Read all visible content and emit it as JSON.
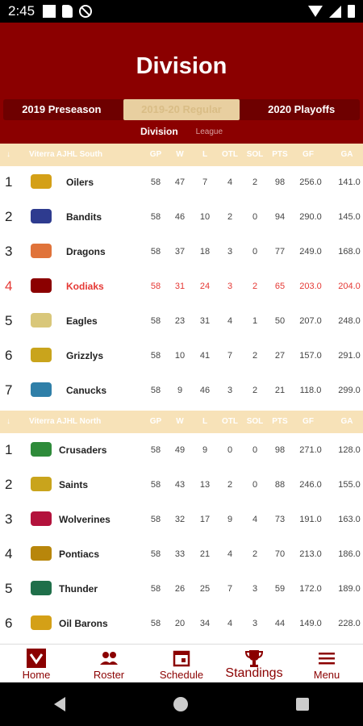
{
  "status": {
    "time": "2:45"
  },
  "header": {
    "title": "Division",
    "seasons": [
      "2019 Preseason",
      "2019-20 Regular",
      "2020 Playoffs"
    ],
    "subtabs": [
      "Division",
      "League"
    ]
  },
  "columns": [
    "GP",
    "W",
    "L",
    "OTL",
    "SOL",
    "PTS",
    "GF",
    "GA"
  ],
  "south": {
    "name": "Viterra AJHL South",
    "rows": [
      {
        "rank": "1",
        "team": "Oilers",
        "gp": "58",
        "w": "47",
        "l": "7",
        "otl": "4",
        "sol": "2",
        "pts": "98",
        "gf": "256.0",
        "ga": "141.0",
        "color": "#d4a017"
      },
      {
        "rank": "2",
        "team": "Bandits",
        "gp": "58",
        "w": "46",
        "l": "10",
        "otl": "2",
        "sol": "0",
        "pts": "94",
        "gf": "290.0",
        "ga": "145.0",
        "color": "#2e3b8f"
      },
      {
        "rank": "3",
        "team": "Dragons",
        "gp": "58",
        "w": "37",
        "l": "18",
        "otl": "3",
        "sol": "0",
        "pts": "77",
        "gf": "249.0",
        "ga": "168.0",
        "color": "#e0733a"
      },
      {
        "rank": "4",
        "team": "Kodiaks",
        "gp": "58",
        "w": "31",
        "l": "24",
        "otl": "3",
        "sol": "2",
        "pts": "65",
        "gf": "203.0",
        "ga": "204.0",
        "color": "#8b0000",
        "hl": true
      },
      {
        "rank": "5",
        "team": "Eagles",
        "gp": "58",
        "w": "23",
        "l": "31",
        "otl": "4",
        "sol": "1",
        "pts": "50",
        "gf": "207.0",
        "ga": "248.0",
        "color": "#d9c77a"
      },
      {
        "rank": "6",
        "team": "Grizzlys",
        "gp": "58",
        "w": "10",
        "l": "41",
        "otl": "7",
        "sol": "2",
        "pts": "27",
        "gf": "157.0",
        "ga": "291.0",
        "color": "#c9a41c"
      },
      {
        "rank": "7",
        "team": "Canucks",
        "gp": "58",
        "w": "9",
        "l": "46",
        "otl": "3",
        "sol": "2",
        "pts": "21",
        "gf": "118.0",
        "ga": "299.0",
        "color": "#2f7fa8"
      }
    ]
  },
  "north": {
    "name": "Viterra AJHL North",
    "rows": [
      {
        "rank": "1",
        "team": "Crusaders",
        "gp": "58",
        "w": "49",
        "l": "9",
        "otl": "0",
        "sol": "0",
        "pts": "98",
        "gf": "271.0",
        "ga": "128.0",
        "color": "#2e8b3a"
      },
      {
        "rank": "2",
        "team": "Saints",
        "gp": "58",
        "w": "43",
        "l": "13",
        "otl": "2",
        "sol": "0",
        "pts": "88",
        "gf": "246.0",
        "ga": "155.0",
        "color": "#c9a41c"
      },
      {
        "rank": "3",
        "team": "Wolverines",
        "gp": "58",
        "w": "32",
        "l": "17",
        "otl": "9",
        "sol": "4",
        "pts": "73",
        "gf": "191.0",
        "ga": "163.0",
        "color": "#b3123c"
      },
      {
        "rank": "4",
        "team": "Pontiacs",
        "gp": "58",
        "w": "33",
        "l": "21",
        "otl": "4",
        "sol": "2",
        "pts": "70",
        "gf": "213.0",
        "ga": "186.0",
        "color": "#b8860b"
      },
      {
        "rank": "5",
        "team": "Thunder",
        "gp": "58",
        "w": "26",
        "l": "25",
        "otl": "7",
        "sol": "3",
        "pts": "59",
        "gf": "172.0",
        "ga": "189.0",
        "color": "#1f6f4a"
      },
      {
        "rank": "6",
        "team": "Oil Barons",
        "gp": "58",
        "w": "20",
        "l": "34",
        "otl": "4",
        "sol": "3",
        "pts": "44",
        "gf": "149.0",
        "ga": "228.0",
        "color": "#d4a017"
      }
    ]
  },
  "nav": [
    {
      "label": "Home",
      "icon": "home-logo-icon"
    },
    {
      "label": "Roster",
      "icon": "people-icon"
    },
    {
      "label": "Schedule",
      "icon": "calendar-icon"
    },
    {
      "label": "Standings",
      "icon": "trophy-icon",
      "active": true
    },
    {
      "label": "Menu",
      "icon": "menu-icon"
    }
  ]
}
